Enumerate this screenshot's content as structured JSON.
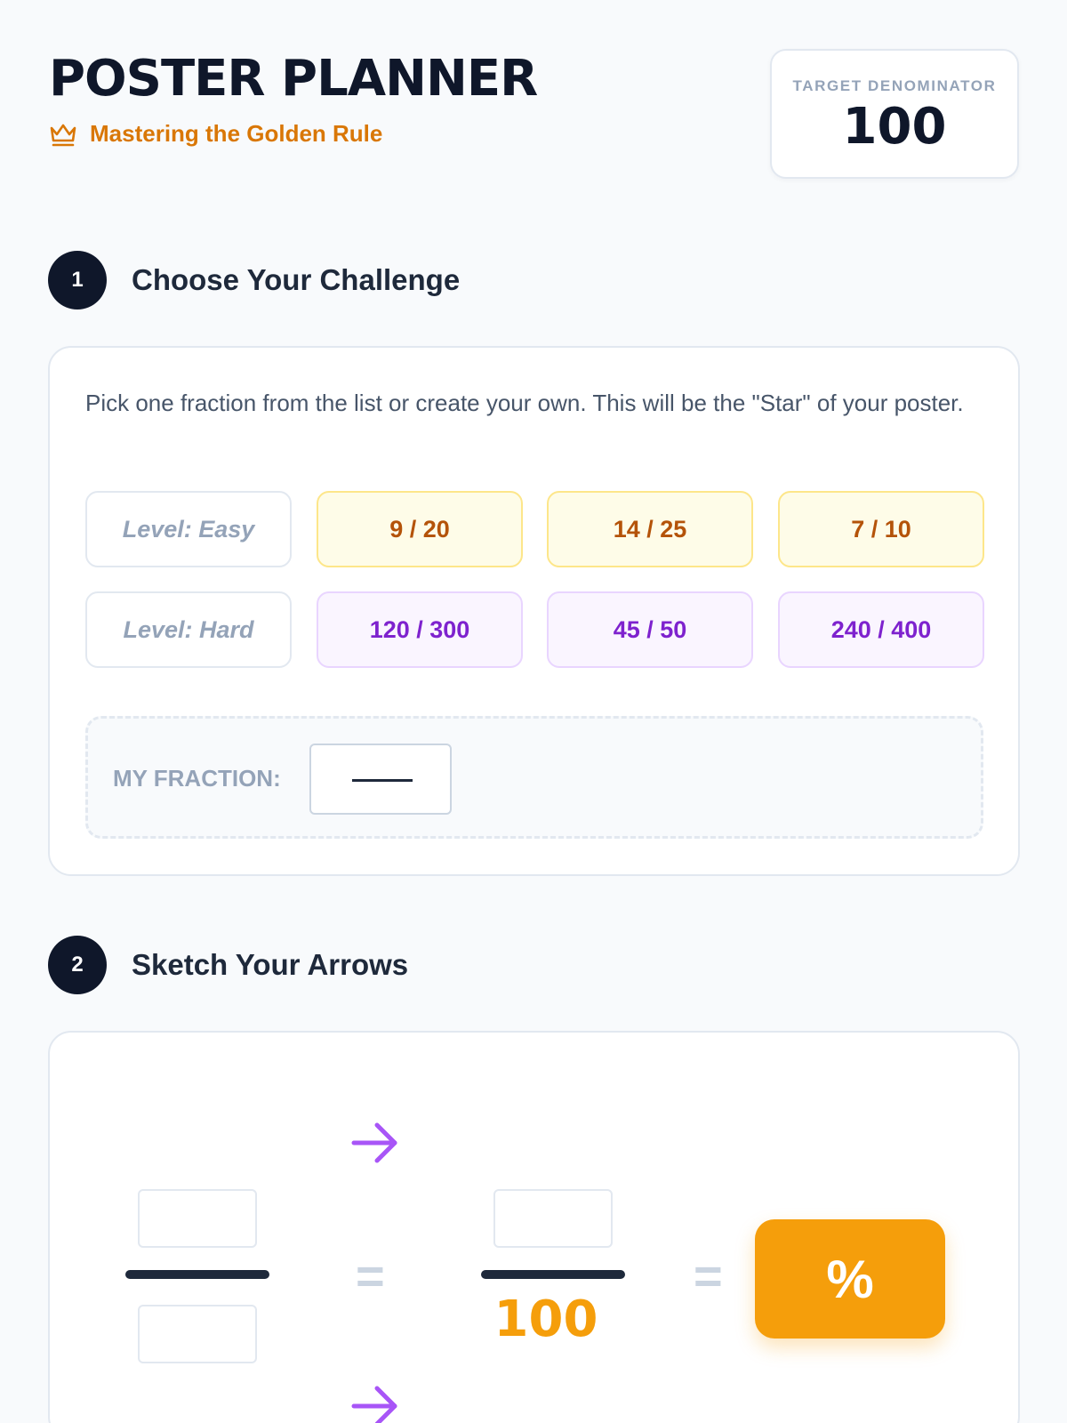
{
  "header": {
    "title": "POSTER PLANNER",
    "subtitle": "Mastering the Golden Rule",
    "subtitle_icon": "crown-icon",
    "target": {
      "label": "TARGET DENOMINATOR",
      "value": "100"
    }
  },
  "step1": {
    "number": "1",
    "title": "Choose Your Challenge",
    "instructions": "Pick one fraction from the list or create your own. This will be the \"Star\" of your poster.",
    "easy": {
      "label": "Level: Easy",
      "fractions": [
        "9 / 20",
        "14 / 25",
        "7 / 10"
      ]
    },
    "hard": {
      "label": "Level: Hard",
      "fractions": [
        "120 / 300",
        "45 / 50",
        "240 / 400"
      ]
    },
    "my_fraction_label": "MY FRACTION:"
  },
  "step2": {
    "number": "2",
    "title": "Sketch Your Arrows",
    "equals": "=",
    "denominator": "100",
    "percent_symbol": "%",
    "arrow_icon": "arrow-right-icon"
  },
  "colors": {
    "accent": "#f59e0b",
    "easy": "#b45309",
    "hard": "#7e22ce",
    "arrow": "#a855f7",
    "dark": "#0f172a"
  }
}
